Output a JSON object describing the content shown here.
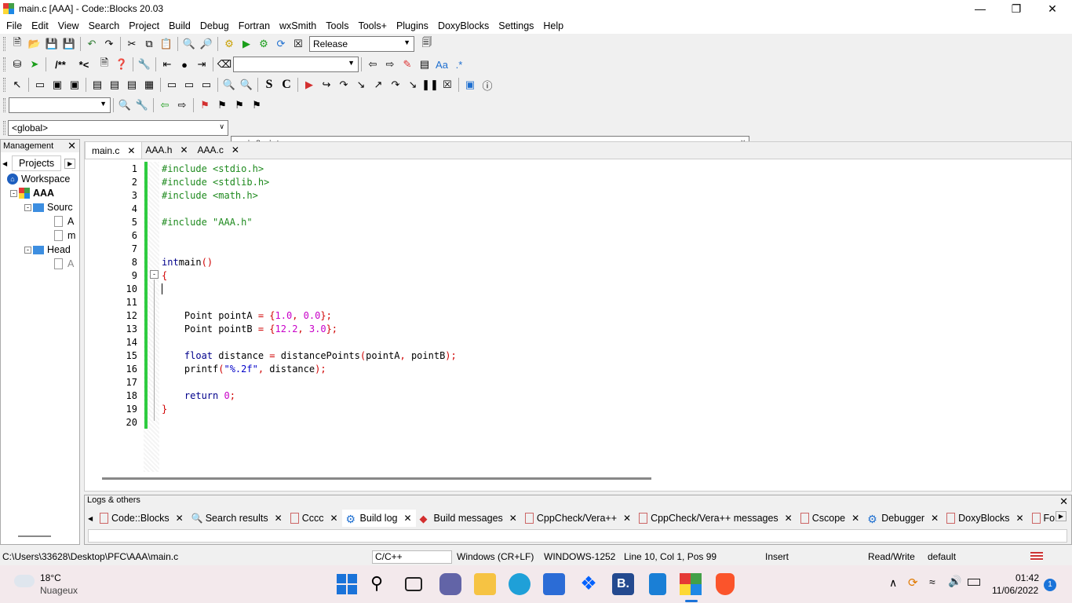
{
  "window": {
    "title": "main.c [AAA] - Code::Blocks 20.03"
  },
  "menu": [
    "File",
    "Edit",
    "View",
    "Search",
    "Project",
    "Build",
    "Debug",
    "Fortran",
    "wxSmith",
    "Tools",
    "Tools+",
    "Plugins",
    "DoxyBlocks",
    "Settings",
    "Help"
  ],
  "toolbar": {
    "build_target": "Release"
  },
  "scope": {
    "global": "<global>",
    "function": "main() : int"
  },
  "management": {
    "title": "Management",
    "tab": "Projects",
    "tree": [
      "Workspace",
      "AAA",
      "Sourc",
      "A",
      "m",
      "Head",
      "A"
    ]
  },
  "editor": {
    "tabs": [
      {
        "label": "main.c"
      },
      {
        "label": "AAA.h"
      },
      {
        "label": "AAA.c"
      }
    ],
    "line_numbers": [
      "1",
      "2",
      "3",
      "4",
      "5",
      "6",
      "7",
      "8",
      "9",
      "10",
      "11",
      "12",
      "13",
      "14",
      "15",
      "16",
      "17",
      "18",
      "19",
      "20"
    ]
  },
  "logs": {
    "title": "Logs & others",
    "tabs": [
      "Code::Blocks",
      "Search results",
      "Cccc",
      "Build log",
      "Build messages",
      "CppCheck/Vera++",
      "CppCheck/Vera++ messages",
      "Cscope",
      "Debugger",
      "DoxyBlocks",
      "Fort"
    ]
  },
  "status": {
    "path": "C:\\Users\\33628\\Desktop\\PFC\\AAA\\main.c",
    "lang": "C/C++",
    "eol": "Windows (CR+LF)",
    "encoding": "WINDOWS-1252",
    "position": "Line 10, Col 1, Pos 99",
    "mode": "Insert",
    "access": "Read/Write",
    "profile": "default"
  },
  "taskbar": {
    "temp": "18°C",
    "weather": "Nuageux",
    "time": "01:42",
    "date": "11/06/2022",
    "notif": "1"
  },
  "colors": {
    "change_bar": "#2ecc40",
    "preprocessor": "#1e8a1e",
    "keyword": "#00008b",
    "number": "#c800c8"
  }
}
